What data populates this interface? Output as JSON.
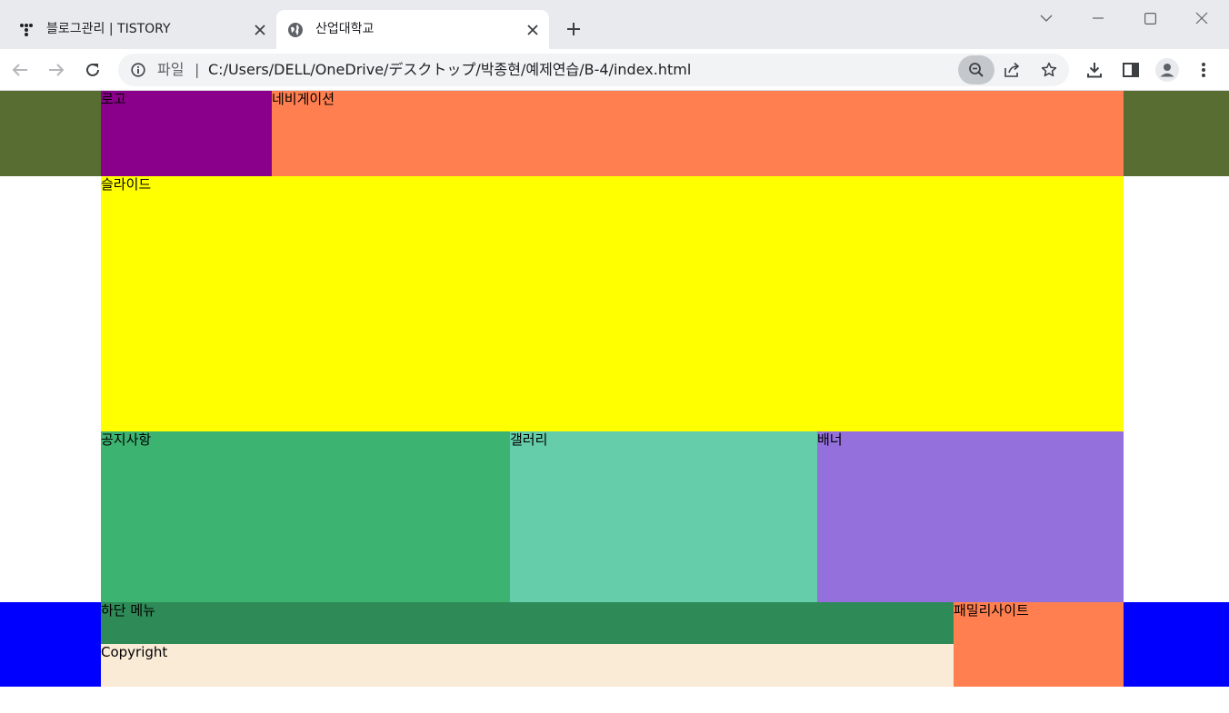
{
  "browser": {
    "tabs": [
      {
        "title": "블로그관리 | TISTORY",
        "active": false,
        "favicon": "tistory-icon"
      },
      {
        "title": "산업대학교",
        "active": true,
        "favicon": "globe-icon"
      }
    ],
    "address": {
      "scheme_label": "파일",
      "separator": "|",
      "url": "C:/Users/DELL/OneDrive/デスクトップ/박종현/예제연습/B-4/index.html"
    }
  },
  "page": {
    "header": {
      "logo": "로고",
      "nav": "네비게이션"
    },
    "slide": "슬라이드",
    "contents": {
      "notice": "공지사항",
      "gallery": "갤러리",
      "banner": "배너"
    },
    "footer": {
      "menu": "하단 메뉴",
      "copyright": "Copyright",
      "family": "패밀리사이트"
    }
  },
  "colors": {
    "header_band": "#586d31",
    "logo": "#8b008b",
    "nav": "#ff7f50",
    "slide": "#ffff00",
    "notice": "#3cb371",
    "gallery": "#66cdaa",
    "banner": "#9370db",
    "footer_band": "#0000ff",
    "footer_menu": "#2e8b57",
    "copyright": "#faebd7",
    "family": "#ff7f50"
  }
}
